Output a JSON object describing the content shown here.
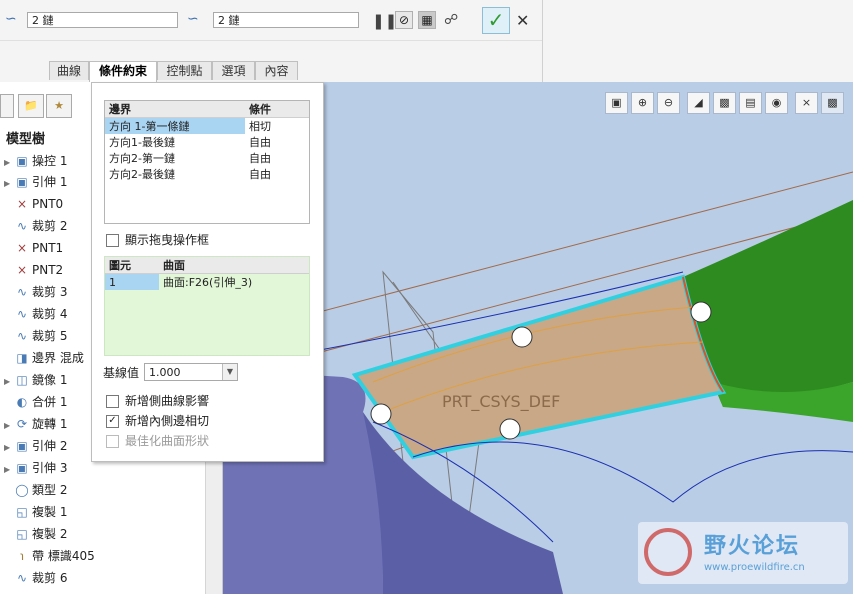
{
  "dashboard": {
    "curve_chain_1": "2 鏈",
    "curve_chain_2": "2 鏈",
    "tabs": [
      "曲線",
      "條件約束",
      "控制點",
      "選項",
      "內容"
    ],
    "active_tab": "條件約束"
  },
  "model_tree": {
    "title": "模型樹",
    "items": [
      {
        "label": "操控 1",
        "expand": true
      },
      {
        "label": "引伸 1",
        "expand": true
      },
      {
        "label": "PNT0",
        "expand": false
      },
      {
        "label": "裁剪 2",
        "expand": false
      },
      {
        "label": "PNT1",
        "expand": false
      },
      {
        "label": "PNT2",
        "expand": false
      },
      {
        "label": "裁剪 3",
        "expand": false
      },
      {
        "label": "裁剪 4",
        "expand": false
      },
      {
        "label": "裁剪 5",
        "expand": false
      },
      {
        "label": "邊界 混成",
        "expand": false
      },
      {
        "label": "鏡像 1",
        "expand": true
      },
      {
        "label": "合併 1",
        "expand": false
      },
      {
        "label": "旋轉 1",
        "expand": true
      },
      {
        "label": "引伸 2",
        "expand": true
      },
      {
        "label": "引伸 3",
        "expand": true
      },
      {
        "label": "類型 2",
        "expand": false
      },
      {
        "label": "複製 1",
        "expand": false
      },
      {
        "label": "複製 2",
        "expand": false
      },
      {
        "label": "帶 標識405",
        "expand": false
      },
      {
        "label": "裁剪 6",
        "expand": false
      }
    ]
  },
  "panel": {
    "boundary_header": "邊界",
    "condition_header": "條件",
    "boundaries": [
      {
        "name": "方向 1-第一條鏈",
        "condition": "相切"
      },
      {
        "name": "方向1-最後鏈",
        "condition": "自由"
      },
      {
        "name": "方向2-第一鏈",
        "condition": "自由"
      },
      {
        "name": "方向2-最後鏈",
        "condition": "自由"
      }
    ],
    "show_drag_label": "顯示拖曳操作框",
    "element_header": "圖元",
    "surface_header": "曲面",
    "element_rows": [
      {
        "element": "1",
        "surface": "曲面:F26(引伸_3)"
      }
    ],
    "stretch_label": "基線值",
    "stretch_value": "1.000",
    "add_side_label": "新增側曲線影響",
    "add_inner_label": "新增內側邊相切",
    "optimize_label": "最佳化曲面形狀"
  },
  "viewport": {
    "csys_label": "PRT_CSYS_DEF",
    "watermark_title": "野火论坛",
    "watermark_url": "www.proewildfire.cn"
  },
  "colors": {
    "accent_green": "#2e8b1f",
    "surface_tan": "#c8a887",
    "highlight_cyan": "#30d0e0",
    "background_blue": "#b9cde6"
  }
}
